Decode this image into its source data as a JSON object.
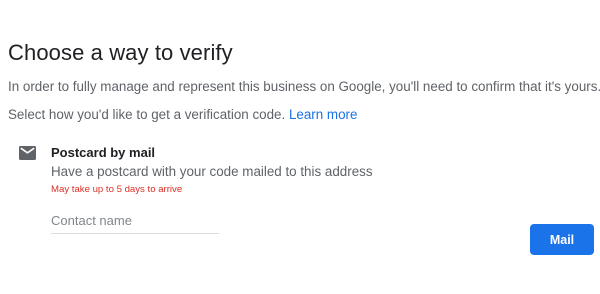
{
  "page": {
    "title": "Choose a way to verify",
    "intro": "In order to fully manage and represent this business on Google, you'll need to confirm that it's yours.",
    "instruction": "Select how you'd like to get a verification code.",
    "learn_more": "Learn more"
  },
  "option": {
    "icon": "envelope-icon",
    "title": "Postcard by mail",
    "description": "Have a postcard with your code mailed to this address",
    "warning": "May take up to 5 days to arrive",
    "contact_placeholder": "Contact name",
    "contact_value": ""
  },
  "actions": {
    "mail_label": "Mail"
  },
  "colors": {
    "accent": "#1a73e8",
    "warning": "#d93025",
    "secondary_text": "#5f6368",
    "icon": "#5f6368"
  }
}
